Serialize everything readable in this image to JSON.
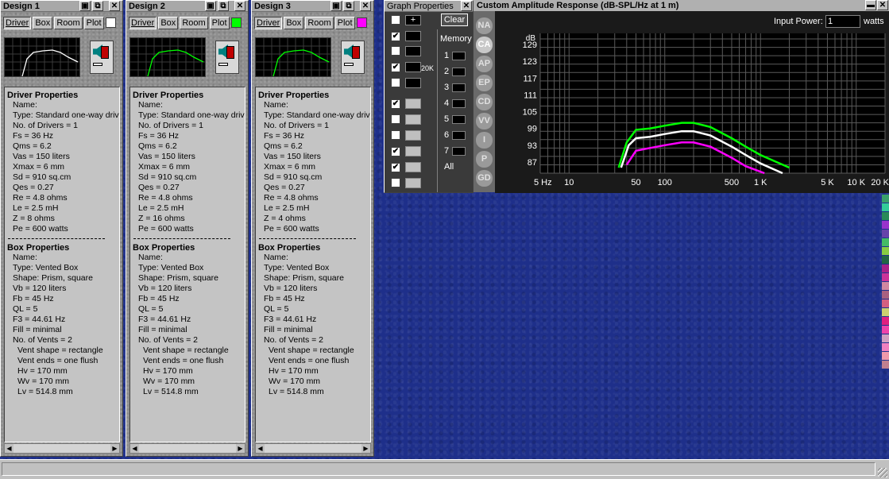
{
  "designs": [
    {
      "title": "Design 1",
      "plot_color": "#ffffff",
      "curve_color": "#ffffff",
      "tabs": [
        "Driver",
        "Box",
        "Room",
        "Plot"
      ],
      "driver_header": "Driver Properties",
      "driver_lines": [
        "Name:",
        "Type: Standard one-way driv",
        "No. of Drivers = 1",
        "Fs  =  36 Hz",
        "Qms  =  6.2",
        "Vas  =  150 liters",
        "Xmax  =  6 mm",
        "Sd  =  910 sq.cm",
        "Qes  =  0.27",
        "Re  =  4.8 ohms",
        "Le  =  2.5 mH",
        "Z  =  8 ohms",
        "Pe  =  600 watts"
      ],
      "box_header": "Box Properties",
      "box_lines": [
        "Name:",
        "Type: Vented Box",
        "Shape: Prism, square",
        "Vb  =  120 liters",
        "Fb  =  45 Hz",
        "QL  =  5",
        "F3  =  44.61 Hz",
        "Fill = minimal",
        "No. of Vents = 2"
      ],
      "vent_lines": [
        "Vent shape = rectangle",
        "Vent ends = one flush",
        "Hv  =  170 mm",
        "Wv  =  170 mm",
        "Lv  =  514.8 mm"
      ]
    },
    {
      "title": "Design 2",
      "plot_color": "#00ff00",
      "curve_color": "#00ff00",
      "tabs": [
        "Driver",
        "Box",
        "Room",
        "Plot"
      ],
      "driver_header": "Driver Properties",
      "driver_lines": [
        "Name:",
        "Type: Standard one-way driv",
        "No. of Drivers = 1",
        "Fs  =  36 Hz",
        "Qms  =  6.2",
        "Vas  =  150 liters",
        "Xmax  =  6 mm",
        "Sd  =  910 sq.cm",
        "Qes  =  0.27",
        "Re  =  4.8 ohms",
        "Le  =  2.5 mH",
        "Z  =  16 ohms",
        "Pe  =  600 watts"
      ],
      "box_header": "Box Properties",
      "box_lines": [
        "Name:",
        "Type: Vented Box",
        "Shape: Prism, square",
        "Vb  =  120 liters",
        "Fb  =  45 Hz",
        "QL  =  5",
        "F3  =  44.61 Hz",
        "Fill = minimal",
        "No. of Vents = 2"
      ],
      "vent_lines": [
        "Vent shape = rectangle",
        "Vent ends = one flush",
        "Hv  =  170 mm",
        "Wv  =  170 mm",
        "Lv  =  514.8 mm"
      ]
    },
    {
      "title": "Design 3",
      "plot_color": "#ff00ff",
      "curve_color": "#00ff00",
      "tabs": [
        "Driver",
        "Box",
        "Room",
        "Plot"
      ],
      "driver_header": "Driver Properties",
      "driver_lines": [
        "Name:",
        "Type: Standard one-way driv",
        "No. of Drivers = 1",
        "Fs  =  36 Hz",
        "Qms  =  6.2",
        "Vas  =  150 liters",
        "Xmax  =  6 mm",
        "Sd  =  910 sq.cm",
        "Qes  =  0.27",
        "Re  =  4.8 ohms",
        "Le  =  2.5 mH",
        "Z  =  4 ohms",
        "Pe  =  600 watts"
      ],
      "box_header": "Box Properties",
      "box_lines": [
        "Name:",
        "Type: Vented Box",
        "Shape: Prism, square",
        "Vb  =  120 liters",
        "Fb  =  45 Hz",
        "QL  =  5",
        "F3  =  44.61 Hz",
        "Fill = minimal",
        "No. of Vents = 2"
      ],
      "vent_lines": [
        "Vent shape = rectangle",
        "Vent ends = one flush",
        "Hv  =  170 mm",
        "Wv  =  170 mm",
        "Lv  =  514.8 mm"
      ]
    }
  ],
  "graph_props": {
    "title": "Graph Properties",
    "clear_label": "Clear",
    "memory_label": "Memory",
    "memory_slots": [
      "1",
      "2",
      "3",
      "4",
      "5",
      "6",
      "7",
      "All"
    ],
    "label_20k": "20K",
    "checked": [
      false,
      true,
      false,
      true,
      false,
      true,
      false,
      false,
      true,
      true,
      false,
      false
    ]
  },
  "side_tabs": [
    "NA",
    "CA",
    "AP",
    "EP",
    "CD",
    "VV",
    "I",
    "P",
    "GD"
  ],
  "active_side_tab": "CA",
  "response": {
    "title": "Custom Amplitude Response (dB-SPL/Hz at 1 m)",
    "input_power_label": "Input Power:",
    "input_power_value": "1",
    "watts_label": "watts"
  },
  "chart_data": {
    "type": "line",
    "title": "Custom Amplitude Response (dB-SPL/Hz at 1 m)",
    "ylabel": "dB",
    "xscale": "log",
    "xlim": [
      5,
      20000
    ],
    "ylim": [
      83,
      133
    ],
    "yticks": [
      87,
      93,
      99,
      105,
      111,
      117,
      123,
      129
    ],
    "xticks": [
      {
        "v": 5,
        "label": "5 Hz"
      },
      {
        "v": 10,
        "label": "10"
      },
      {
        "v": 50,
        "label": "50"
      },
      {
        "v": 100,
        "label": "100"
      },
      {
        "v": 500,
        "label": "500"
      },
      {
        "v": 1000,
        "label": "1 K"
      },
      {
        "v": 5000,
        "label": "5 K"
      },
      {
        "v": 10000,
        "label": "10 K"
      },
      {
        "v": 20000,
        "label": "20 K"
      }
    ],
    "grid": true,
    "series": [
      {
        "color": "#00ff00",
        "x": [
          33,
          40,
          50,
          70,
          100,
          150,
          200,
          300,
          500,
          700,
          1000,
          2000
        ],
        "y": [
          85,
          94,
          98.5,
          99,
          100,
          101,
          101,
          99.5,
          95.5,
          92.5,
          89.5,
          85
        ]
      },
      {
        "color": "#ffffff",
        "x": [
          35,
          42,
          50,
          70,
          100,
          150,
          200,
          300,
          500,
          700,
          1000,
          1700
        ],
        "y": [
          85,
          93,
          95.5,
          96,
          97,
          98,
          98,
          96.5,
          92.5,
          89.5,
          86.5,
          83
        ]
      },
      {
        "color": "#ff00ff",
        "x": [
          40,
          50,
          70,
          100,
          150,
          200,
          300,
          500,
          700,
          1100
        ],
        "y": [
          86,
          91,
          92,
          93,
          94,
          94,
          92.5,
          88.5,
          85.5,
          83
        ]
      }
    ]
  }
}
